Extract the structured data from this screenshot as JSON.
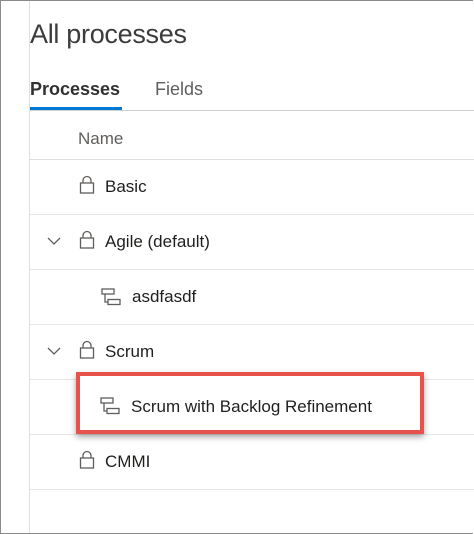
{
  "page": {
    "title": "All processes"
  },
  "tabs": [
    {
      "label": "Processes",
      "selected": true
    },
    {
      "label": "Fields",
      "selected": false
    }
  ],
  "table": {
    "header": "Name",
    "rows": [
      {
        "name": "Basic",
        "icon": "lock-icon",
        "expandable": false,
        "inherited": false
      },
      {
        "name": "Agile (default)",
        "icon": "lock-icon",
        "expandable": true,
        "expanded": true,
        "inherited": false
      },
      {
        "name": "asdfasdf",
        "icon": "inherited-process-icon",
        "expandable": false,
        "inherited": true
      },
      {
        "name": "Scrum",
        "icon": "lock-icon",
        "expandable": true,
        "expanded": true,
        "inherited": false
      },
      {
        "name": "Scrum with Backlog Refinement",
        "icon": "inherited-process-icon",
        "expandable": false,
        "inherited": true,
        "highlighted": true
      },
      {
        "name": "CMMI",
        "icon": "lock-icon",
        "expandable": false,
        "inherited": false
      }
    ]
  },
  "colors": {
    "accent": "#0078d4",
    "highlight_border": "#e8524a",
    "text": "#201f1e",
    "muted_text": "#605e5c"
  }
}
